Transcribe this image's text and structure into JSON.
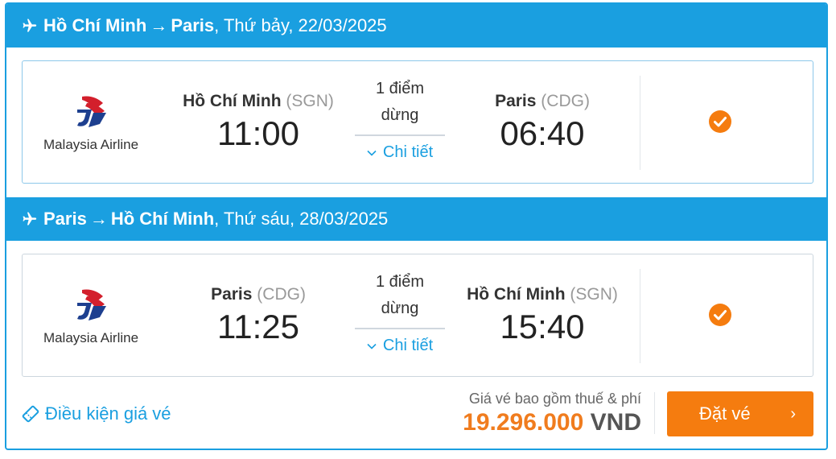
{
  "colors": {
    "primary": "#1a9fe0",
    "accent": "#f57c0f",
    "price": "#f07c1e"
  },
  "legs": [
    {
      "header": {
        "origin": "Hồ Chí Minh",
        "arrow": "→",
        "destination": "Paris",
        "date": ", Thứ bảy, 22/03/2025"
      },
      "airline": {
        "name": "Malaysia Airline",
        "logo_icon": "malaysia-airlines-logo"
      },
      "departure": {
        "city": "Hồ Chí Minh",
        "code": "(SGN)",
        "time": "11:00"
      },
      "stops": {
        "line1": "1 điểm",
        "line2": "dừng",
        "detail_label": "Chi tiết"
      },
      "arrival": {
        "city": "Paris",
        "code": "(CDG)",
        "time": "06:40"
      },
      "selected": true
    },
    {
      "header": {
        "origin": "Paris",
        "arrow": "→",
        "destination": "Hồ Chí Minh",
        "date": ", Thứ sáu, 28/03/2025"
      },
      "airline": {
        "name": "Malaysia Airline",
        "logo_icon": "malaysia-airlines-logo"
      },
      "departure": {
        "city": "Paris",
        "code": "(CDG)",
        "time": "11:25"
      },
      "stops": {
        "line1": "1 điểm",
        "line2": "dừng",
        "detail_label": "Chi tiết"
      },
      "arrival": {
        "city": "Hồ Chí Minh",
        "code": "(SGN)",
        "time": "15:40"
      },
      "selected": true
    }
  ],
  "footer": {
    "conditions_label": "Điều kiện giá vé",
    "price_note": "Giá vé bao gồm thuế & phí",
    "price_amount": "19.296.000",
    "price_currency": "VND",
    "book_label": "Đặt vé",
    "book_chevron": "›"
  }
}
